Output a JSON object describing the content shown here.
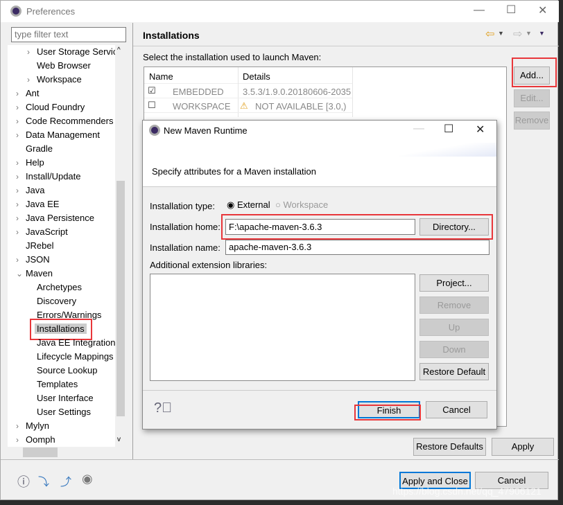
{
  "window": {
    "title": "Preferences"
  },
  "filter": {
    "placeholder": "type filter text"
  },
  "tree": [
    {
      "label": "User Storage Servic",
      "level": 2,
      "chevron": "right"
    },
    {
      "label": "Web Browser",
      "level": 2,
      "chevron": ""
    },
    {
      "label": "Workspace",
      "level": 2,
      "chevron": "right"
    },
    {
      "label": "Ant",
      "level": 1,
      "chevron": "right"
    },
    {
      "label": "Cloud Foundry",
      "level": 1,
      "chevron": "right"
    },
    {
      "label": "Code Recommenders",
      "level": 1,
      "chevron": "right"
    },
    {
      "label": "Data Management",
      "level": 1,
      "chevron": "right"
    },
    {
      "label": "Gradle",
      "level": 1,
      "chevron": ""
    },
    {
      "label": "Help",
      "level": 1,
      "chevron": "right"
    },
    {
      "label": "Install/Update",
      "level": 1,
      "chevron": "right"
    },
    {
      "label": "Java",
      "level": 1,
      "chevron": "right"
    },
    {
      "label": "Java EE",
      "level": 1,
      "chevron": "right"
    },
    {
      "label": "Java Persistence",
      "level": 1,
      "chevron": "right"
    },
    {
      "label": "JavaScript",
      "level": 1,
      "chevron": "right"
    },
    {
      "label": "JRebel",
      "level": 1,
      "chevron": ""
    },
    {
      "label": "JSON",
      "level": 1,
      "chevron": "right"
    },
    {
      "label": "Maven",
      "level": 1,
      "chevron": "down"
    },
    {
      "label": "Archetypes",
      "level": 2,
      "chevron": ""
    },
    {
      "label": "Discovery",
      "level": 2,
      "chevron": ""
    },
    {
      "label": "Errors/Warnings",
      "level": 2,
      "chevron": ""
    },
    {
      "label": "Installations",
      "level": 2,
      "chevron": "",
      "selected": true
    },
    {
      "label": "Java EE Integration",
      "level": 2,
      "chevron": ""
    },
    {
      "label": "Lifecycle Mappings",
      "level": 2,
      "chevron": ""
    },
    {
      "label": "Source Lookup",
      "level": 2,
      "chevron": ""
    },
    {
      "label": "Templates",
      "level": 2,
      "chevron": ""
    },
    {
      "label": "User Interface",
      "level": 2,
      "chevron": ""
    },
    {
      "label": "User Settings",
      "level": 2,
      "chevron": ""
    },
    {
      "label": "Mylyn",
      "level": 1,
      "chevron": "right"
    },
    {
      "label": "Oomph",
      "level": 1,
      "chevron": "right"
    }
  ],
  "page": {
    "title": "Installations",
    "description": "Select the installation used to launch Maven:",
    "columns": [
      "Name",
      "Details"
    ],
    "rows": [
      {
        "checked": true,
        "name": "EMBEDDED",
        "details": "3.5.3/1.9.0.20180606-2035",
        "warning": false
      },
      {
        "checked": false,
        "name": "WORKSPACE",
        "details": "NOT AVAILABLE [3.0,)",
        "warning": true
      }
    ],
    "buttons": {
      "add": "Add...",
      "edit": "Edit...",
      "remove": "Remove"
    },
    "restore_defaults": "Restore Defaults",
    "apply": "Apply"
  },
  "footer": {
    "apply_close": "Apply and Close",
    "cancel": "Cancel"
  },
  "dialog": {
    "title": "New Maven Runtime",
    "description": "Specify attributes for a Maven installation",
    "type_label": "Installation type:",
    "type_options": [
      "External",
      "Workspace"
    ],
    "type_selected": "External",
    "home_label": "Installation home:",
    "home_value": "F:\\apache-maven-3.6.3",
    "directory_btn": "Directory...",
    "name_label": "Installation name:",
    "name_value": "apache-maven-3.6.3",
    "libs_label": "Additional extension libraries:",
    "lib_buttons": {
      "project": "Project...",
      "remove": "Remove",
      "up": "Up",
      "down": "Down",
      "restore": "Restore Default"
    },
    "finish": "Finish",
    "cancel": "Cancel"
  },
  "watermark": "https://blog.csdn.net/qq_47906121",
  "colors": {
    "highlight": "#e8363a",
    "focus": "#0078d7"
  }
}
